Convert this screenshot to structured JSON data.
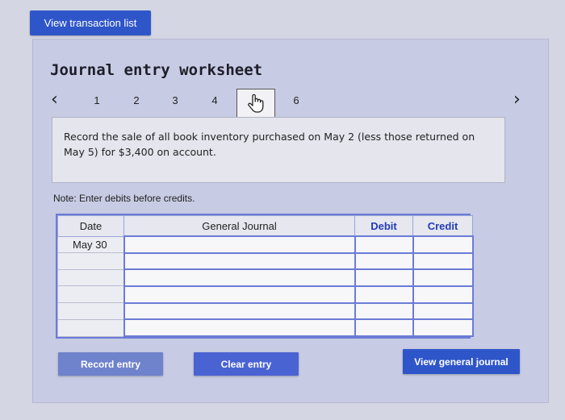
{
  "toolbar": {
    "view_transactions_label": "View transaction list"
  },
  "worksheet": {
    "title": "Journal entry worksheet",
    "steps": [
      "1",
      "2",
      "3",
      "4",
      "6"
    ],
    "current_step_icon": "pointer-hand-icon",
    "instruction": "Record the sale of all book inventory purchased on May 2 (less those returned on May 5) for $3,400 on account.",
    "note": "Note: Enter debits before credits."
  },
  "table": {
    "headers": {
      "date": "Date",
      "journal": "General Journal",
      "debit": "Debit",
      "credit": "Credit"
    },
    "rows": [
      {
        "date": "May 30"
      },
      {
        "date": ""
      },
      {
        "date": ""
      },
      {
        "date": ""
      },
      {
        "date": ""
      },
      {
        "date": ""
      }
    ]
  },
  "actions": {
    "record_label": "Record entry",
    "clear_label": "Clear entry",
    "view_journal_label": "View general journal"
  }
}
